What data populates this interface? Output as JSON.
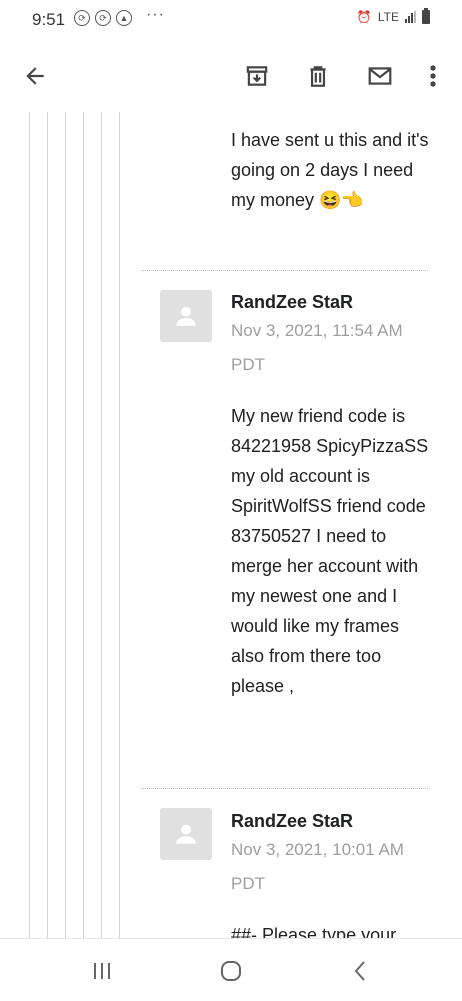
{
  "status_bar": {
    "time": "9:51",
    "more": "···",
    "network": "LTE"
  },
  "messages": [
    {
      "body": "I have sent u this and it's going on 2 days I need my money 😆👈"
    },
    {
      "sender": "RandZee StaR",
      "date": "Nov 3, 2021, 11:54 AM PDT",
      "body": "My new friend code is 84221958 SpicyPizzaSS my old account is SpiritWolfSS friend code 83750527 I need to merge her account with my newest one and I would like my frames also from there too please ,"
    },
    {
      "sender": "RandZee StaR",
      "date": "Nov 3, 2021, 10:01 AM PDT",
      "body": "##- Please type your"
    }
  ],
  "icons": {
    "back": "arrow-left-icon",
    "archive": "archive-icon",
    "delete": "trash-icon",
    "mark_unread": "mail-icon",
    "more": "more-vert-icon",
    "recents": "recents-icon",
    "home": "home-icon",
    "nav_back": "chevron-left-icon"
  }
}
